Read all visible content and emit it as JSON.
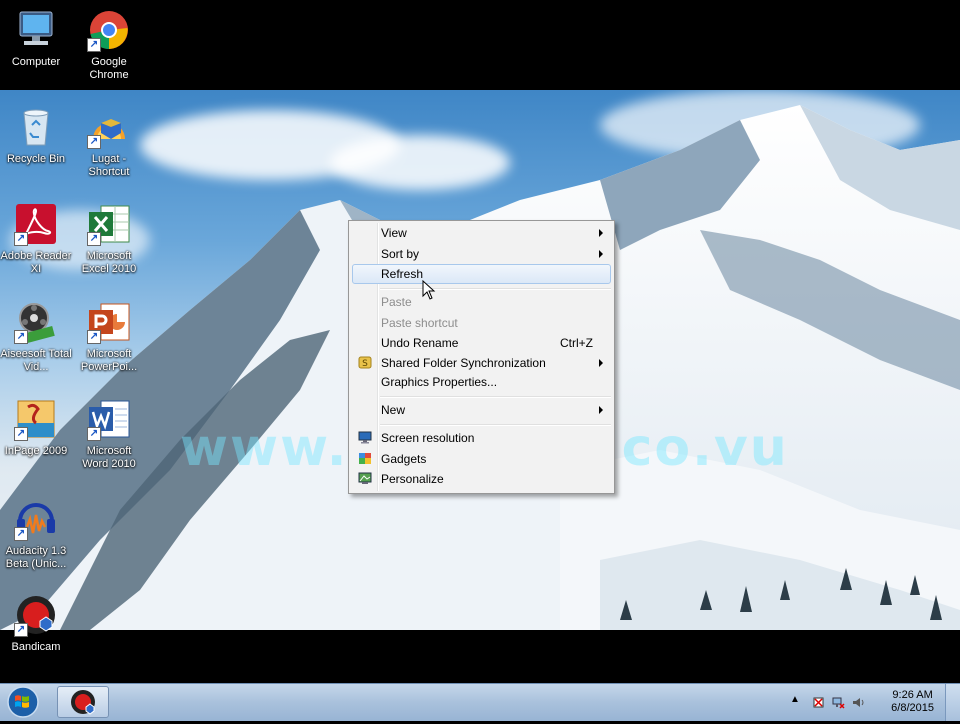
{
  "desktop": {
    "icons": [
      {
        "label": "Computer"
      },
      {
        "label": "Google Chrome"
      },
      {
        "label": "Recycle Bin"
      },
      {
        "label": "Lugat - Shortcut"
      },
      {
        "label": "Adobe Reader XI"
      },
      {
        "label": "Microsoft Excel 2010"
      },
      {
        "label": "Aiseesoft Total Vid..."
      },
      {
        "label": "Microsoft PowerPoi..."
      },
      {
        "label": "InPage 2009"
      },
      {
        "label": "Microsoft Word 2010"
      },
      {
        "label": "Audacity 1.3 Beta (Unic..."
      },
      {
        "label": "Bandicam"
      }
    ],
    "watermark": "www.Grabfun.co.vu"
  },
  "context_menu": {
    "items": [
      {
        "label": "View"
      },
      {
        "label": "Sort by"
      },
      {
        "label": "Refresh"
      },
      {
        "label": "Paste"
      },
      {
        "label": "Paste shortcut"
      },
      {
        "label": "Undo Rename",
        "shortcut": "Ctrl+Z"
      },
      {
        "label": "Shared Folder Synchronization"
      },
      {
        "label": "Graphics Properties..."
      },
      {
        "label": "New"
      },
      {
        "label": "Screen resolution"
      },
      {
        "label": "Gadgets"
      },
      {
        "label": "Personalize"
      }
    ]
  },
  "taskbar": {
    "clock_time": "9:26 AM",
    "clock_date": "6/8/2015"
  },
  "colors": {
    "menu_highlight": "#dbe8f7",
    "taskbar": "#a9c1dc"
  }
}
